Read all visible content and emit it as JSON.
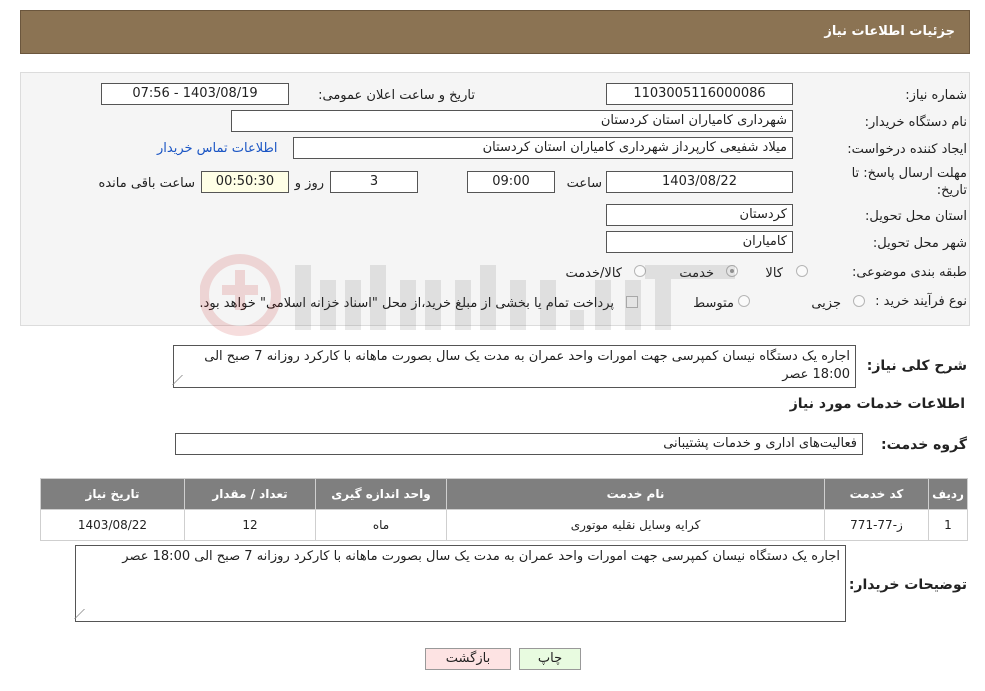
{
  "header": {
    "title": "جزئیات اطلاعات نیاز"
  },
  "form": {
    "need_number_label": "شماره نیاز:",
    "need_number": "1103005116000086",
    "announce_label": "تاریخ و ساعت اعلان عمومی:",
    "announce_value": "1403/08/19 - 07:56",
    "buyer_org_label": "نام دستگاه خریدار:",
    "buyer_org": "شهرداری کامیاران استان کردستان",
    "creator_label": "ایجاد کننده درخواست:",
    "creator": "میلاد شفیعی کارپرداز شهرداری کامیاران استان کردستان",
    "contact_link": "اطلاعات تماس خریدار",
    "deadline_label_1": "مهلت ارسال پاسخ: تا",
    "deadline_label_2": "تاریخ:",
    "deadline_date": "1403/08/22",
    "time_label": "ساعت",
    "deadline_time": "09:00",
    "days_value": "3",
    "days_label": "روز و",
    "remaining_value": "00:50:30",
    "remaining_label": "ساعت باقی مانده",
    "province_label": "استان محل تحویل:",
    "province": "کردستان",
    "city_label": "شهر محل تحویل:",
    "city": "کامیاران",
    "category_label": "طبقه بندی موضوعی:",
    "category_options": [
      "کالا",
      "خدمت",
      "کالا/خدمت"
    ],
    "category_selected": "خدمت",
    "process_label": "نوع فرآیند خرید :",
    "process_options": [
      "جزیی",
      "متوسط"
    ],
    "payment_note": "پرداخت تمام یا بخشی از مبلغ خرید،از محل \"اسناد خزانه اسلامی\" خواهد بود."
  },
  "summary": {
    "label": "شرح کلی نیاز:",
    "text": "اجاره یک دستگاه نیسان کمپرسی جهت امورات واحد عمران به مدت یک سال بصورت ماهانه با کارکرد روزانه 7 صبح الی 18:00 عصر"
  },
  "services_section": {
    "title": "اطلاعات خدمات مورد نیاز",
    "group_label": "گروه خدمت:",
    "group_value": "فعالیت‌های اداری و خدمات پشتیبانی"
  },
  "table": {
    "headers": [
      "ردیف",
      "کد خدمت",
      "نام خدمت",
      "واحد اندازه گیری",
      "تعداد / مقدار",
      "تاریخ نیاز"
    ],
    "rows": [
      [
        "1",
        "ز-77-771",
        "کرایه وسایل نقلیه موتوری",
        "ماه",
        "12",
        "1403/08/22"
      ]
    ]
  },
  "buyer_notes": {
    "label": "توضیحات خریدار:",
    "text": "اجاره یک دستگاه نیسان کمپرسی جهت امورات واحد عمران به مدت یک سال بصورت ماهانه با کارکرد روزانه 7 صبح الی 18:00 عصر"
  },
  "buttons": {
    "print": "چاپ",
    "back": "بازگشت"
  },
  "colors": {
    "header_bg": "#8b7353",
    "table_header_bg": "#7f7f7f",
    "back_button_bg": "#fde3e3",
    "print_button_bg": "#e8fbe0",
    "link": "#1a55c4"
  }
}
